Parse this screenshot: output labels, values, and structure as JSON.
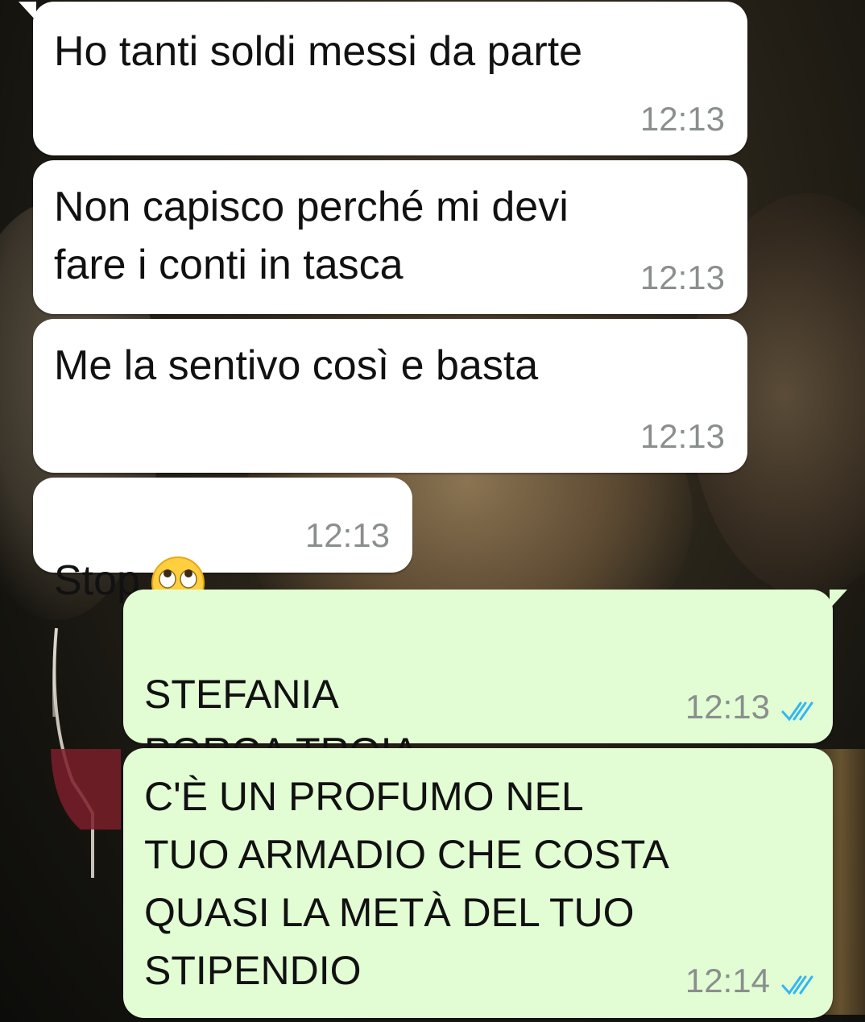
{
  "messages": [
    {
      "direction": "in",
      "text": "Ho tanti soldi messi da parte",
      "time": "12:13"
    },
    {
      "direction": "in",
      "text": "Non capisco perché mi devi\nfare i conti in tasca",
      "time": "12:13"
    },
    {
      "direction": "in",
      "text": "Me la sentivo così e basta",
      "time": "12:13"
    },
    {
      "direction": "in",
      "text": "Stop",
      "emoji": "face-with-rolling-eyes",
      "time": "12:13"
    },
    {
      "direction": "out",
      "text": "STEFANIA",
      "struck_text": "PORCA TROIA",
      "time": "12:13",
      "status": "read"
    },
    {
      "direction": "out",
      "text": "C'È UN PROFUMO NEL\nTUO ARMADIO CHE COSTA\nQUASI LA METÀ DEL TUO\nSTIPENDIO",
      "time": "12:14",
      "status": "read"
    }
  ],
  "colors": {
    "incoming_bubble": "#ffffff",
    "outgoing_bubble": "#e2fdd4",
    "timestamp": "#8a8f8d",
    "read_ticks": "#34b7f1"
  },
  "icons": {
    "read_receipt": "double-check-icon",
    "emoji": "face-with-rolling-eyes"
  }
}
